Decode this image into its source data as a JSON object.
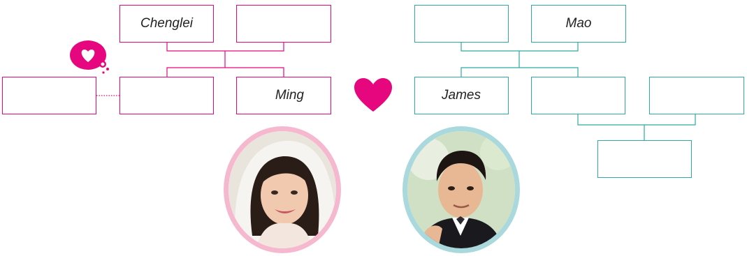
{
  "colors": {
    "bride_side": "#e6077e",
    "groom_side": "#2fa9a3",
    "bride_portrait_ring": "#f5b8cf",
    "groom_portrait_ring": "#a9d8dd"
  },
  "bride_family": {
    "parents": [
      {
        "name": "Chenglei"
      },
      {
        "name": ""
      }
    ],
    "children": [
      {
        "name": ""
      },
      {
        "name": "Ming"
      }
    ],
    "partner_of_sibling": {
      "name": ""
    },
    "thought_bubble_icon": "heart-thought-bubble-icon"
  },
  "groom_family": {
    "parents": [
      {
        "name": ""
      },
      {
        "name": "Mao"
      }
    ],
    "children": [
      {
        "name": "James"
      },
      {
        "name": ""
      }
    ],
    "in_law_branch": {
      "spouse": {
        "name": ""
      },
      "child": {
        "name": ""
      }
    }
  },
  "center_icon": "heart-icon",
  "portraits": {
    "bride": "bride-photo",
    "groom": "groom-photo"
  }
}
